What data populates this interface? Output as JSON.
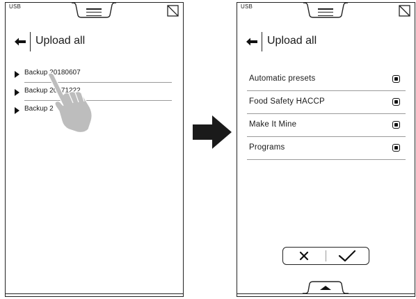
{
  "left_screen": {
    "usb_label": "USB",
    "title": "Upload all",
    "backups": [
      {
        "label": "Backup 20180607"
      },
      {
        "label": "Backup 20171222"
      },
      {
        "label": "Backup 2"
      }
    ]
  },
  "right_screen": {
    "usb_label": "USB",
    "title": "Upload all",
    "options": [
      {
        "label": "Automatic presets",
        "checked": true
      },
      {
        "label": "Food Safety HACCP",
        "checked": true
      },
      {
        "label": "Make It Mine",
        "checked": true
      },
      {
        "label": "Programs",
        "checked": true
      }
    ],
    "cancel_icon": "close-icon",
    "confirm_icon": "checkmark-icon"
  },
  "colors": {
    "ink": "#1a1a1a",
    "hand": "#bdbdbd",
    "divider": "#999999"
  }
}
